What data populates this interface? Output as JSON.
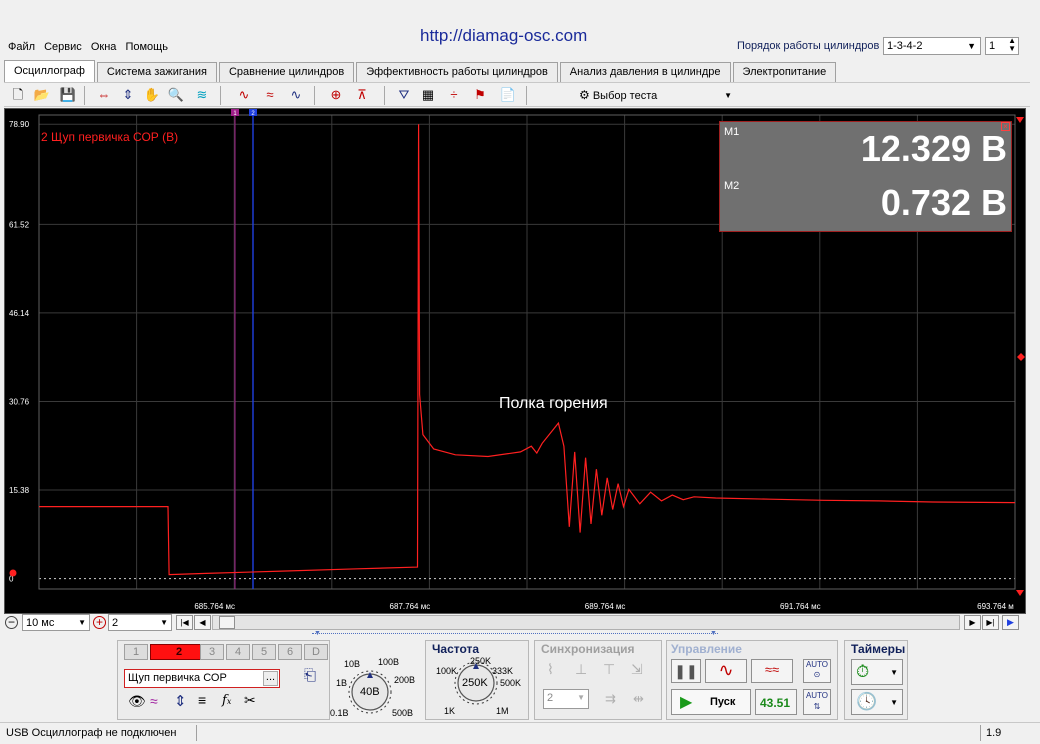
{
  "watermark": "http://diamag-osc.com",
  "menu": [
    "Файл",
    "Сервис",
    "Окна",
    "Помощь"
  ],
  "firing_order": {
    "label": "Порядок работы цилиндров",
    "value": "1-3-4-2",
    "cylinder": "1"
  },
  "tabs": [
    "Осциллограф",
    "Система зажигания",
    "Сравнение цилиндров",
    "Эффективность работы цилиндров",
    "Анализ давления в цилиндре",
    "Электропитание"
  ],
  "toolbar": {
    "test_select": "Выбор теста"
  },
  "channel_label": "2 Щуп первичка СОР (В)",
  "y_ticks": [
    "78.90",
    "61.52",
    "46.14",
    "30.76",
    "15.38",
    "0"
  ],
  "x_ticks": [
    "685.764 мс",
    "687.764 мс",
    "689.764 мс",
    "691.764 мс",
    "693.764 м"
  ],
  "annotation": "Полка горения",
  "measure": {
    "m1_label": "M1",
    "m1_value": "12.329 В",
    "m2_label": "M2",
    "m2_value": "0.732 В"
  },
  "cursor_markers": [
    "1",
    "2"
  ],
  "bottom": {
    "time_div": "10 мс",
    "channel_sel": "2",
    "channels": [
      "1",
      "2",
      "3",
      "4",
      "5",
      "6",
      "D"
    ],
    "probe_name": "Щуп первичка СОР",
    "probe_btn": "...",
    "volt_title": "",
    "volt_labels": {
      "a": "10В",
      "b": "100В",
      "c": "1В",
      "d": "200В",
      "e": "0.1В",
      "f": "500В",
      "center": "40В"
    },
    "freq_title": "Частота",
    "freq_labels": {
      "a": "250K",
      "b": "100K",
      "c": "333K",
      "d": "500K",
      "e": "1K",
      "f": "1M",
      "center": "250K"
    },
    "sync_title": "Синхронизация",
    "sync_value": "2",
    "control_title": "Управление",
    "run_label": "Пуск",
    "fps": "43.51",
    "timers_title": "Таймеры"
  },
  "status": {
    "left": "USB Осциллограф не подключен",
    "right": "1.9"
  },
  "colors": {
    "trace": "#ff2020",
    "grid": "#3a3a3a",
    "cursor1": "#a0208a",
    "cursor2": "#2040e0",
    "measure_bg": "#707070"
  },
  "chart_data": {
    "type": "line",
    "title": "",
    "xlabel": "",
    "ylabel": "2 Щуп первичка СОР (В)",
    "x_unit": "мс",
    "xlim": [
      684.76,
      693.76
    ],
    "ylim": [
      -1.8,
      80.5
    ],
    "series": [
      {
        "name": "2 Щуп первичка СОР (В)",
        "x": [
          684.76,
          685.5,
          685.85,
          685.95,
          685.96,
          686.3,
          687.0,
          687.7,
          688.25,
          688.26,
          688.27,
          688.3,
          688.4,
          688.6,
          688.9,
          689.2,
          689.3,
          689.35,
          689.4,
          689.55,
          689.6,
          689.65,
          689.7,
          689.75,
          689.8,
          689.85,
          689.9,
          689.95,
          690.0,
          690.05,
          690.1,
          690.15,
          690.2,
          690.3,
          690.4,
          690.5,
          690.6,
          690.7,
          690.8,
          691.0,
          691.5,
          692.0,
          692.5,
          693.0,
          693.76
        ],
        "y": [
          12.5,
          12.5,
          12.5,
          12.5,
          0.7,
          0.9,
          1.3,
          1.7,
          2.0,
          78.9,
          32.0,
          25.0,
          22.5,
          21.5,
          21.2,
          22.0,
          23.0,
          21.8,
          23.5,
          27.0,
          23.0,
          9.0,
          22.0,
          8.0,
          21.0,
          9.5,
          19.0,
          11.0,
          17.5,
          12.0,
          16.5,
          12.5,
          15.5,
          13.0,
          15.0,
          13.5,
          14.5,
          13.7,
          14.2,
          14.0,
          13.8,
          13.6,
          13.5,
          13.3,
          13.2
        ]
      }
    ]
  }
}
